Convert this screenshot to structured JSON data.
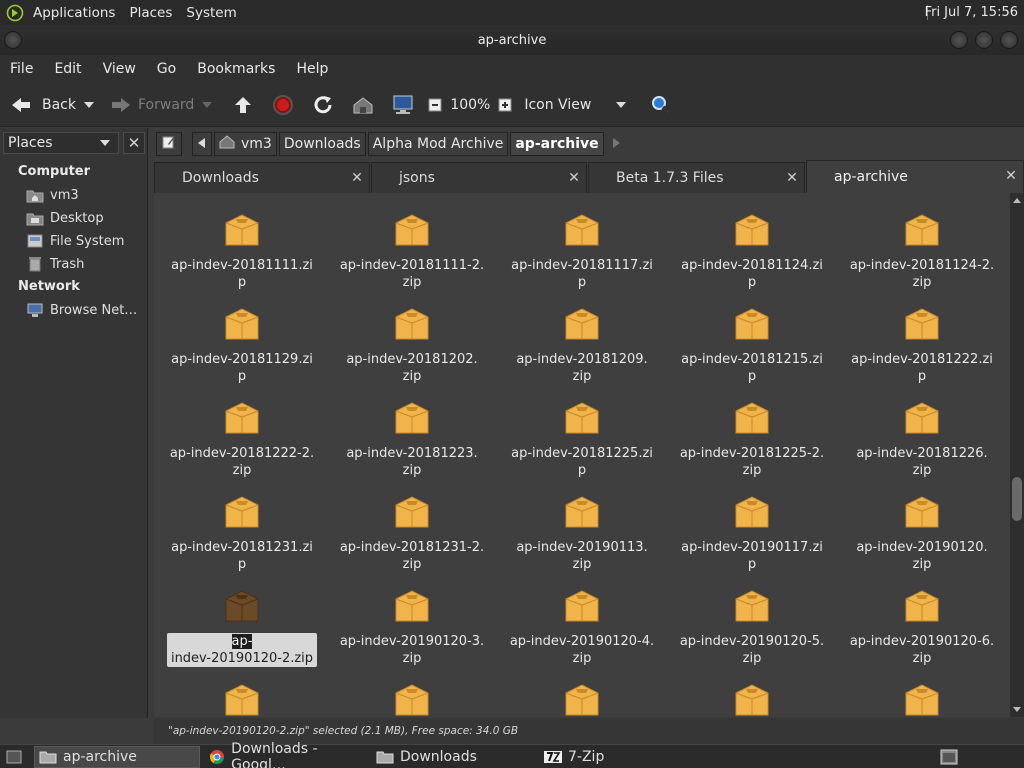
{
  "top_panel": {
    "menus": [
      "Applications",
      "Places",
      "System"
    ],
    "clock": "Fri Jul  7, 15:56"
  },
  "window": {
    "title": "ap-archive"
  },
  "menubar": [
    "File",
    "Edit",
    "View",
    "Go",
    "Bookmarks",
    "Help"
  ],
  "toolbar": {
    "back_label": "Back",
    "forward_label": "Forward",
    "zoom_level": "100%",
    "view_mode": "Icon View"
  },
  "sidebar": {
    "combo_label": "Places",
    "close_glyph": "✕",
    "sections": [
      {
        "title": "Computer",
        "items": [
          "vm3",
          "Desktop",
          "File System",
          "Trash"
        ]
      },
      {
        "title": "Network",
        "items": [
          "Browse Net…"
        ]
      }
    ]
  },
  "pathbar": {
    "crumbs": [
      "vm3",
      "Downloads",
      "Alpha Mod Archive",
      "ap-archive"
    ],
    "active_index": 3
  },
  "tabs": [
    {
      "label": "Downloads",
      "active": false
    },
    {
      "label": "jsons",
      "active": false
    },
    {
      "label": "Beta 1.7.3 Files",
      "active": false
    },
    {
      "label": "ap-archive",
      "active": true
    }
  ],
  "tab_close_glyph": "✕",
  "files": [
    [
      "ap-indev-20181111.zip",
      "ap-indev-20181111-2.zip",
      "ap-indev-20181117.zip",
      "ap-indev-20181124.zip",
      "ap-indev-20181124-2.zip"
    ],
    [
      "ap-indev-20181129.zip",
      "ap-indev-20181202.zip",
      "ap-indev-20181209.zip",
      "ap-indev-20181215.zip",
      "ap-indev-20181222.zip"
    ],
    [
      "ap-indev-20181222-2.zip",
      "ap-indev-20181223.zip",
      "ap-indev-20181225.zip",
      "ap-indev-20181225-2.zip",
      "ap-indev-20181226.zip"
    ],
    [
      "ap-indev-20181231.zip",
      "ap-indev-20181231-2.zip",
      "ap-indev-20190113.zip",
      "ap-indev-20190117.zip",
      "ap-indev-20190120.zip"
    ],
    [
      "ap-indev-20190120-2.zip",
      "ap-indev-20190120-3.zip",
      "ap-indev-20190120-4.zip",
      "ap-indev-20190120-5.zip",
      "ap-indev-20190120-6.zip"
    ],
    [
      "",
      "",
      "",
      "",
      ""
    ]
  ],
  "file_lines": [
    [
      [
        "ap-indev-20181111.zip"
      ],
      [
        "ap-indev-20181111-2.",
        "zip"
      ],
      [
        "ap-indev-20181117.zip"
      ],
      [
        "ap-indev-20181124.zip"
      ],
      [
        "ap-indev-20181124-2.",
        "zip"
      ]
    ],
    [
      [
        "ap-indev-20181129.zip"
      ],
      [
        "ap-indev-20181202.",
        "zip"
      ],
      [
        "ap-indev-20181209.",
        "zip"
      ],
      [
        "ap-indev-20181215.zip"
      ],
      [
        "ap-indev-20181222.zip"
      ]
    ],
    [
      [
        "ap-indev-20181222-2.",
        "zip"
      ],
      [
        "ap-indev-20181223.",
        "zip"
      ],
      [
        "ap-indev-20181225.zip"
      ],
      [
        "ap-indev-20181225-2.",
        "zip"
      ],
      [
        "ap-indev-20181226.",
        "zip"
      ]
    ],
    [
      [
        "ap-indev-20181231.zip"
      ],
      [
        "ap-indev-20181231-2.",
        "zip"
      ],
      [
        "ap-indev-20190113.",
        "zip"
      ],
      [
        "ap-indev-20190117.zip"
      ],
      [
        "ap-indev-20190120.",
        "zip"
      ]
    ],
    [
      [
        "ap-",
        "indev-20190120-2.zip"
      ],
      [
        "ap-indev-20190120-3.",
        "zip"
      ],
      [
        "ap-indev-20190120-4.",
        "zip"
      ],
      [
        "ap-indev-20190120-5.",
        "zip"
      ],
      [
        "ap-indev-20190120-6.",
        "zip"
      ]
    ],
    [
      [
        ""
      ],
      [
        ""
      ],
      [
        ""
      ],
      [
        ""
      ],
      [
        ""
      ]
    ]
  ],
  "selected_file": "ap-indev-20190120-2.zip",
  "status": "\"ap-indev-20190120-2.zip\" selected (2.1 MB), Free space: 34.0 GB",
  "scroll": {
    "position_fraction": 0.6
  },
  "taskbar": [
    {
      "label": "ap-archive",
      "active": true,
      "icon": "folder-icon"
    },
    {
      "label": "Downloads - Googl…",
      "active": false,
      "icon": "chrome-icon"
    },
    {
      "label": "Downloads",
      "active": false,
      "icon": "folder-icon"
    },
    {
      "label": "7-Zip",
      "active": false,
      "icon": "7zip-icon"
    }
  ],
  "colors": {
    "folder_fill": "#f0b44a",
    "folder_shade": "#c98a28",
    "selected_fill": "#6b4a26"
  }
}
